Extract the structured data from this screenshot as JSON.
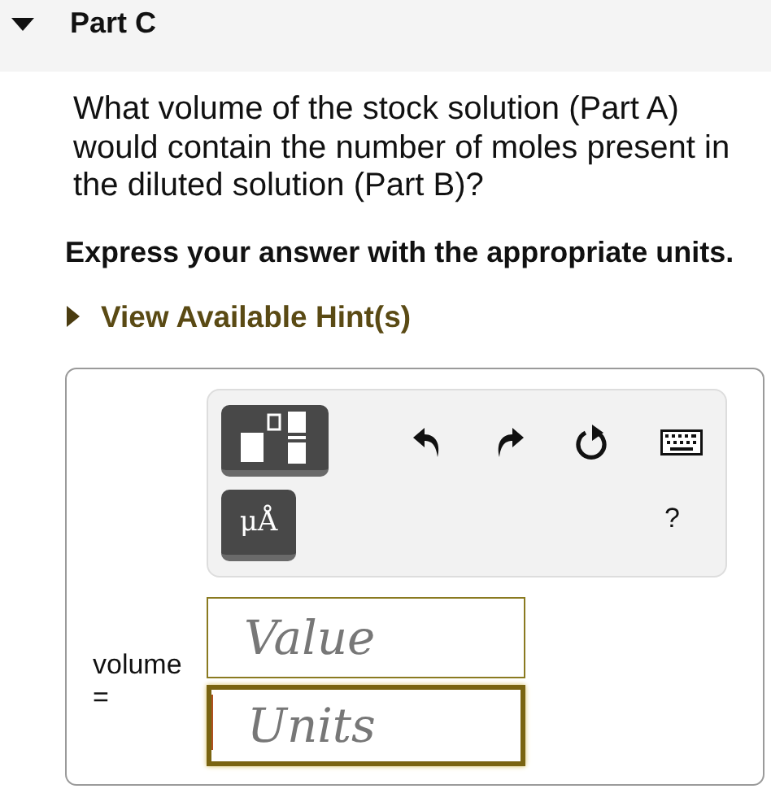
{
  "part": {
    "title": "Part C",
    "expanded": true
  },
  "question": "What volume of the stock solution (Part A) would contain the number of moles present in the diluted solution (Part B)?",
  "instruction": "Express your answer with the appropriate units.",
  "hint": {
    "label": "View Available Hint(s)",
    "expanded": false
  },
  "toolbar": {
    "buttons": [
      {
        "kind": "templates"
      },
      {
        "kind": "units",
        "label": "μÅ"
      }
    ],
    "actions": [
      {
        "kind": "undo"
      },
      {
        "kind": "redo"
      },
      {
        "kind": "reset"
      },
      {
        "kind": "keyboard"
      }
    ],
    "help": "?"
  },
  "answer": {
    "label": "volume",
    "equals": "=",
    "fields": [
      {
        "placeholder": "Value",
        "focused": false
      },
      {
        "placeholder": "Units",
        "focused": true
      }
    ]
  }
}
